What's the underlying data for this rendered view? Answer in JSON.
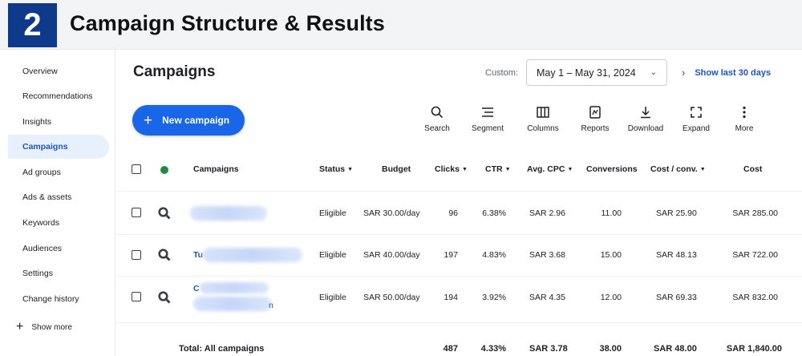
{
  "header": {
    "step_number": "2",
    "title": "Campaign Structure & Results"
  },
  "sidebar": {
    "items": [
      {
        "label": "Overview"
      },
      {
        "label": "Recommendations"
      },
      {
        "label": "Insights"
      },
      {
        "label": "Campaigns",
        "active": true
      },
      {
        "label": "Ad groups"
      },
      {
        "label": "Ads & assets"
      },
      {
        "label": "Keywords"
      },
      {
        "label": "Audiences"
      },
      {
        "label": "Settings"
      },
      {
        "label": "Change history"
      }
    ],
    "show_more": "Show more"
  },
  "main": {
    "title": "Campaigns",
    "date_range": {
      "label": "Custom",
      "value": "May 1 – May 31, 2024"
    },
    "show_last_30": "Show last 30 days",
    "new_campaign": "New campaign",
    "toolbar": [
      {
        "label": "Search",
        "icon": "search-icon"
      },
      {
        "label": "Segment",
        "icon": "segment-icon"
      },
      {
        "label": "Columns",
        "icon": "columns-icon"
      },
      {
        "label": "Reports",
        "icon": "reports-icon"
      },
      {
        "label": "Download",
        "icon": "download-icon"
      },
      {
        "label": "Expand",
        "icon": "expand-icon"
      },
      {
        "label": "More",
        "icon": "more-vert-icon"
      }
    ]
  },
  "table": {
    "headers": {
      "campaigns": "Campaigns",
      "status": "Status",
      "budget": "Budget",
      "clicks": "Clicks",
      "ctr": "CTR",
      "avg_cpc": "Avg. CPC",
      "conversions": "Conversions",
      "cost_conv": "Cost / conv.",
      "cost": "Cost"
    },
    "rows": [
      {
        "name_visible": "",
        "status": "Eligible",
        "budget": "SAR 30.00/day",
        "clicks": "96",
        "ctr": "6.38%",
        "avg_cpc": "SAR 2.96",
        "conversions": "11.00",
        "cost_conv": "SAR 25.90",
        "cost": "SAR 285.00"
      },
      {
        "name_visible": "Tu",
        "status": "Eligible",
        "budget": "SAR 40.00/day",
        "clicks": "197",
        "ctr": "4.83%",
        "avg_cpc": "SAR 3.68",
        "conversions": "15.00",
        "cost_conv": "SAR 48.13",
        "cost": "SAR 722.00"
      },
      {
        "name_visible": "C",
        "name_suffix": "n",
        "status": "Eligible",
        "budget": "SAR 50.00/day",
        "clicks": "194",
        "ctr": "3.92%",
        "avg_cpc": "SAR 4.35",
        "conversions": "12.00",
        "cost_conv": "SAR 69.33",
        "cost": "SAR 832.00"
      }
    ],
    "total": {
      "label": "Total: All campaigns",
      "clicks": "487",
      "ctr": "4.33%",
      "avg_cpc": "SAR 3.78",
      "conversions": "38.00",
      "cost_conv": "SAR 48.00",
      "cost": "SAR 1,840.00"
    }
  },
  "colors": {
    "brand_blue": "#0f3a8c",
    "primary": "#1a66e8",
    "link": "#1a56c4",
    "status_green": "#1e8e3e"
  }
}
